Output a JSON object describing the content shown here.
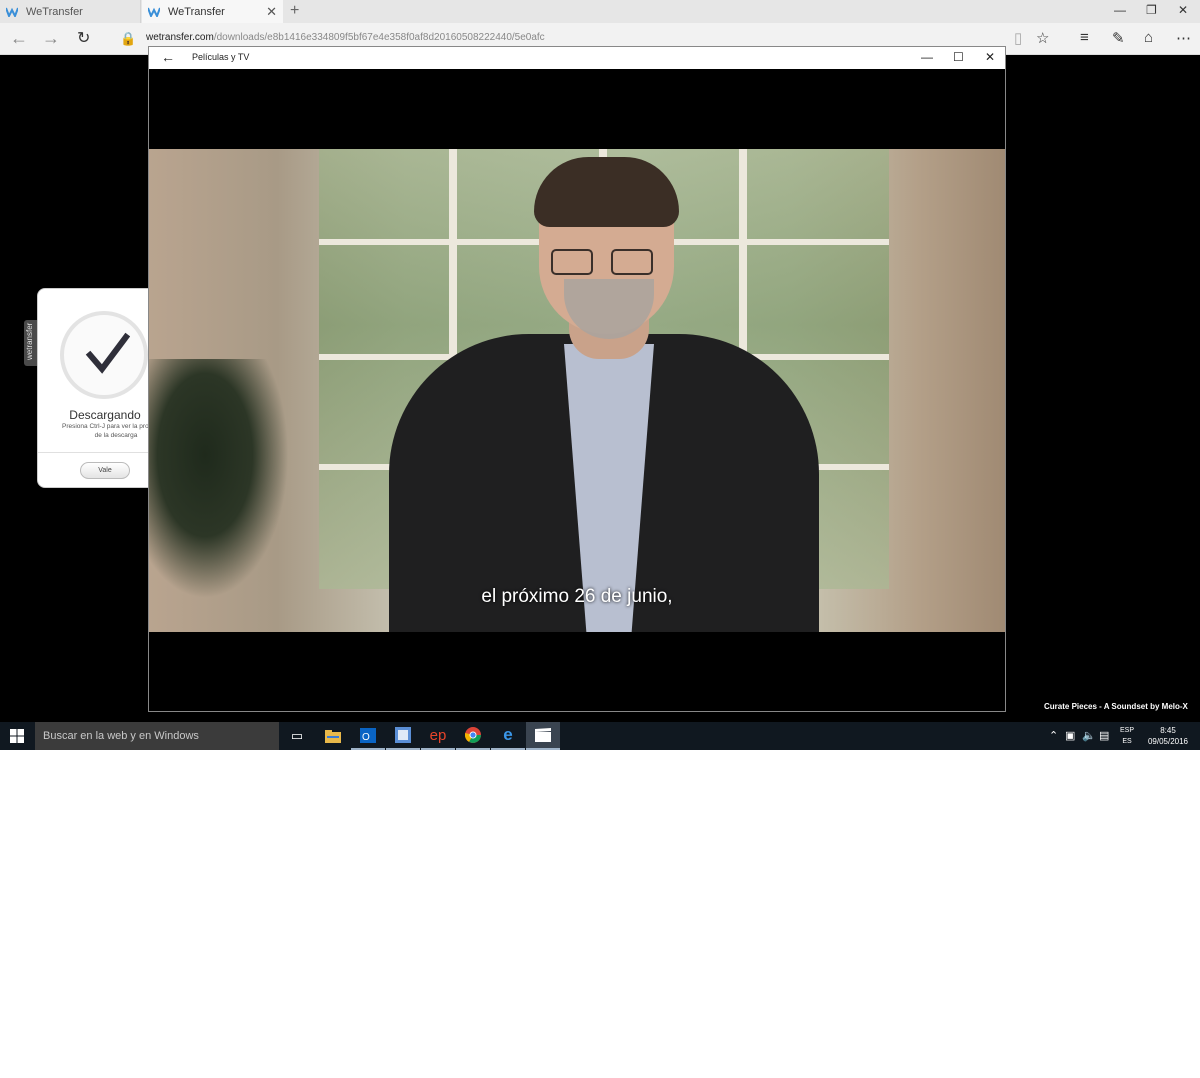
{
  "browser": {
    "tabs": [
      {
        "label": "WeTransfer"
      },
      {
        "label": "WeTransfer"
      }
    ],
    "url_host": "wetransfer.com",
    "url_path": "/downloads/e8b1416e334809f5bf67e4e358f0af8d20160508222440/5e0afc",
    "new_tab_glyph": "+"
  },
  "movies_app": {
    "title": "Películas y TV",
    "subtitle": "el próximo 26 de junio,"
  },
  "wetransfer_panel": {
    "side_tab": "wetransfer",
    "title": "Descargando",
    "subtitle": "Presiona Ctrl-J para ver la progresión de la descarga",
    "button": "Vale"
  },
  "wallpaper_credit": "Curate Pieces - A Soundset by Melo-X",
  "taskbar": {
    "search_placeholder": "Buscar en la web y en Windows",
    "apps": [
      "task-view",
      "file-explorer",
      "outlook",
      "app-e",
      "ep",
      "chrome",
      "edge",
      "movies-tv"
    ],
    "lang_top": "ESP",
    "lang_bottom": "ES",
    "time": "8:45",
    "date": "09/05/2016"
  },
  "colors": {
    "taskbar": "#101820",
    "accent": "#0078d7"
  }
}
